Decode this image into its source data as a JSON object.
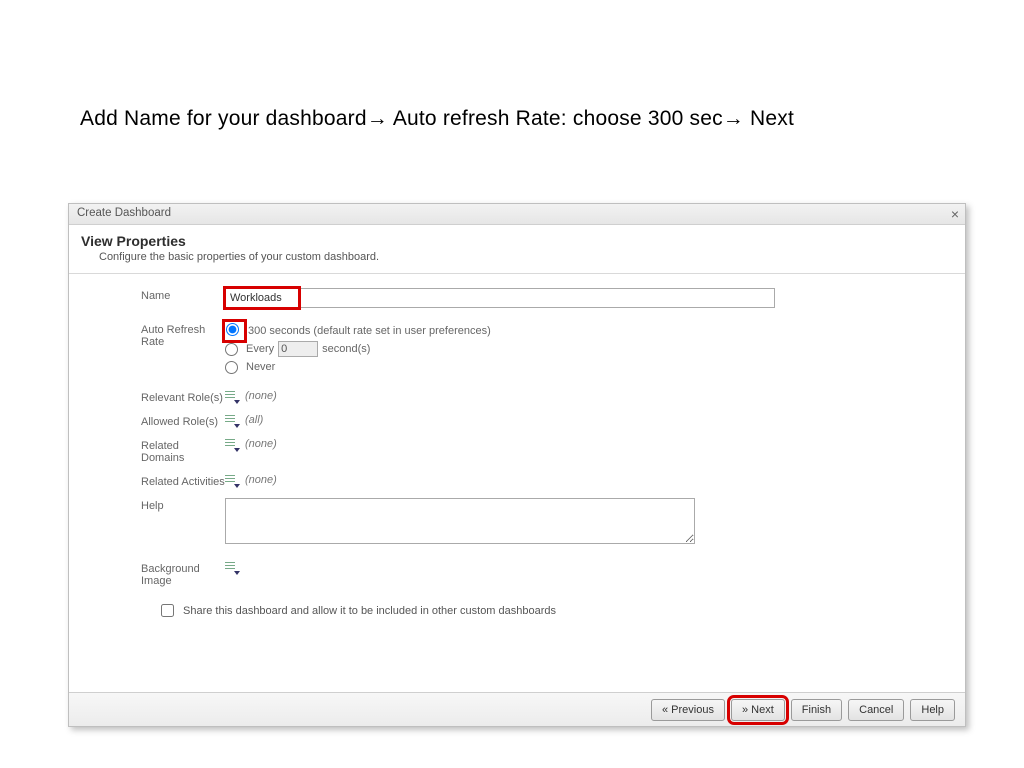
{
  "instruction": {
    "part1": "Add Name for your dashboard",
    "part2": " Auto refresh Rate: choose 300 sec",
    "part3": " Next"
  },
  "dialog": {
    "title": "Create Dashboard",
    "header_title": "View Properties",
    "header_sub": "Configure the basic properties of your custom dashboard."
  },
  "form": {
    "name_label": "Name",
    "name_value": "Workloads",
    "refresh_label": "Auto Refresh Rate",
    "refresh_opt1": "300 seconds (default rate set in user preferences)",
    "refresh_opt2_prefix": "Every",
    "refresh_opt2_value": "0",
    "refresh_opt2_suffix": "second(s)",
    "refresh_opt3": "Never",
    "relevant_roles_label": "Relevant Role(s)",
    "relevant_roles_value": "(none)",
    "allowed_roles_label": "Allowed Role(s)",
    "allowed_roles_value": "(all)",
    "related_domains_label": "Related Domains",
    "related_domains_value": "(none)",
    "related_activities_label": "Related Activities",
    "related_activities_value": "(none)",
    "help_label": "Help",
    "bg_label": "Background Image",
    "share_label": "Share this dashboard and allow it to be included in other custom dashboards"
  },
  "buttons": {
    "previous": "« Previous",
    "next": "» Next",
    "finish": "Finish",
    "cancel": "Cancel",
    "help": "Help"
  }
}
